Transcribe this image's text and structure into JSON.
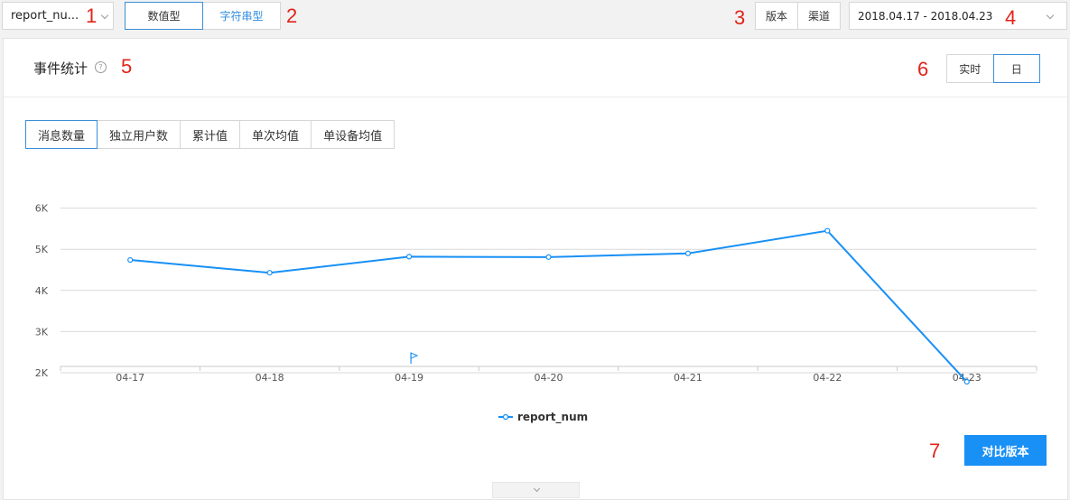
{
  "toolbar": {
    "metric_select": {
      "value": "report_nu..."
    },
    "type_options": [
      {
        "label": "数值型",
        "active": true
      },
      {
        "label": "字符串型",
        "active": false
      }
    ],
    "filters": [
      "版本",
      "渠道"
    ],
    "date_range": "2018.04.17 - 2018.04.23"
  },
  "annotations": [
    "1",
    "2",
    "3",
    "4",
    "5",
    "6",
    "7"
  ],
  "panel": {
    "title": "事件统计",
    "help_icon": "question-circle-icon",
    "granularity": [
      {
        "label": "实时",
        "active": false
      },
      {
        "label": "日",
        "active": true
      }
    ],
    "metric_tabs": [
      {
        "label": "消息数量",
        "active": true
      },
      {
        "label": "独立用户数",
        "active": false
      },
      {
        "label": "累计值",
        "active": false
      },
      {
        "label": "单次均值",
        "active": false
      },
      {
        "label": "单设备均值",
        "active": false
      }
    ],
    "compare_button": "对比版本"
  },
  "colors": {
    "accent": "#1890f5",
    "annotation": "#e3231a",
    "series": "#1890f5"
  },
  "chart_data": {
    "type": "line",
    "x": [
      "04-17",
      "04-18",
      "04-19",
      "04-20",
      "04-21",
      "04-22",
      "04-23"
    ],
    "yticks": [
      "2K",
      "3K",
      "4K",
      "5K",
      "6K"
    ],
    "ylim": [
      1500,
      6000
    ],
    "grid": true,
    "legend_position": "bottom-center",
    "series": [
      {
        "name": "report_num",
        "values": [
          4740,
          4430,
          4820,
          4810,
          4900,
          5450,
          1780
        ]
      }
    ],
    "markers": [
      {
        "x": "04-19",
        "icon": "flag-icon"
      }
    ]
  }
}
